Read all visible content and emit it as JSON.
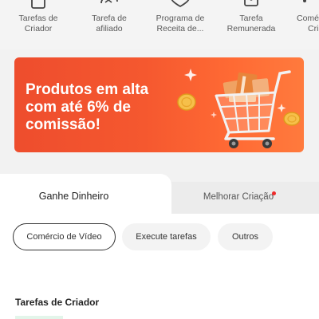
{
  "top_nav": [
    {
      "icon": "clipboard-icon",
      "line1": "Tarefas de",
      "line2": "Criador"
    },
    {
      "icon": "affiliate-cloud-icon",
      "line1": "Tarefa de",
      "line2": "afiliado"
    },
    {
      "icon": "heart-shield-icon",
      "line1": "Programa de",
      "line2": "Receita de..."
    },
    {
      "icon": "flag-icon",
      "line1": "Tarefa",
      "line2": "Remunerada"
    },
    {
      "icon": "more-icon",
      "line1": "Comé",
      "line2": "Cri"
    }
  ],
  "banner": {
    "line1": "Produtos em alta",
    "line2": "com até 6% de",
    "line3": "comissão!"
  },
  "tabs": {
    "active": "Ganhe Dinheiro",
    "inactive": "Melhorar Criação"
  },
  "chips": [
    "Comércio de Vídeo",
    "Execute tarefas",
    "Outros"
  ],
  "section_title": "Tarefas de Criador",
  "colors": {
    "brand_orange": "#ee4d2d",
    "notify_red": "#ee2a2a"
  }
}
